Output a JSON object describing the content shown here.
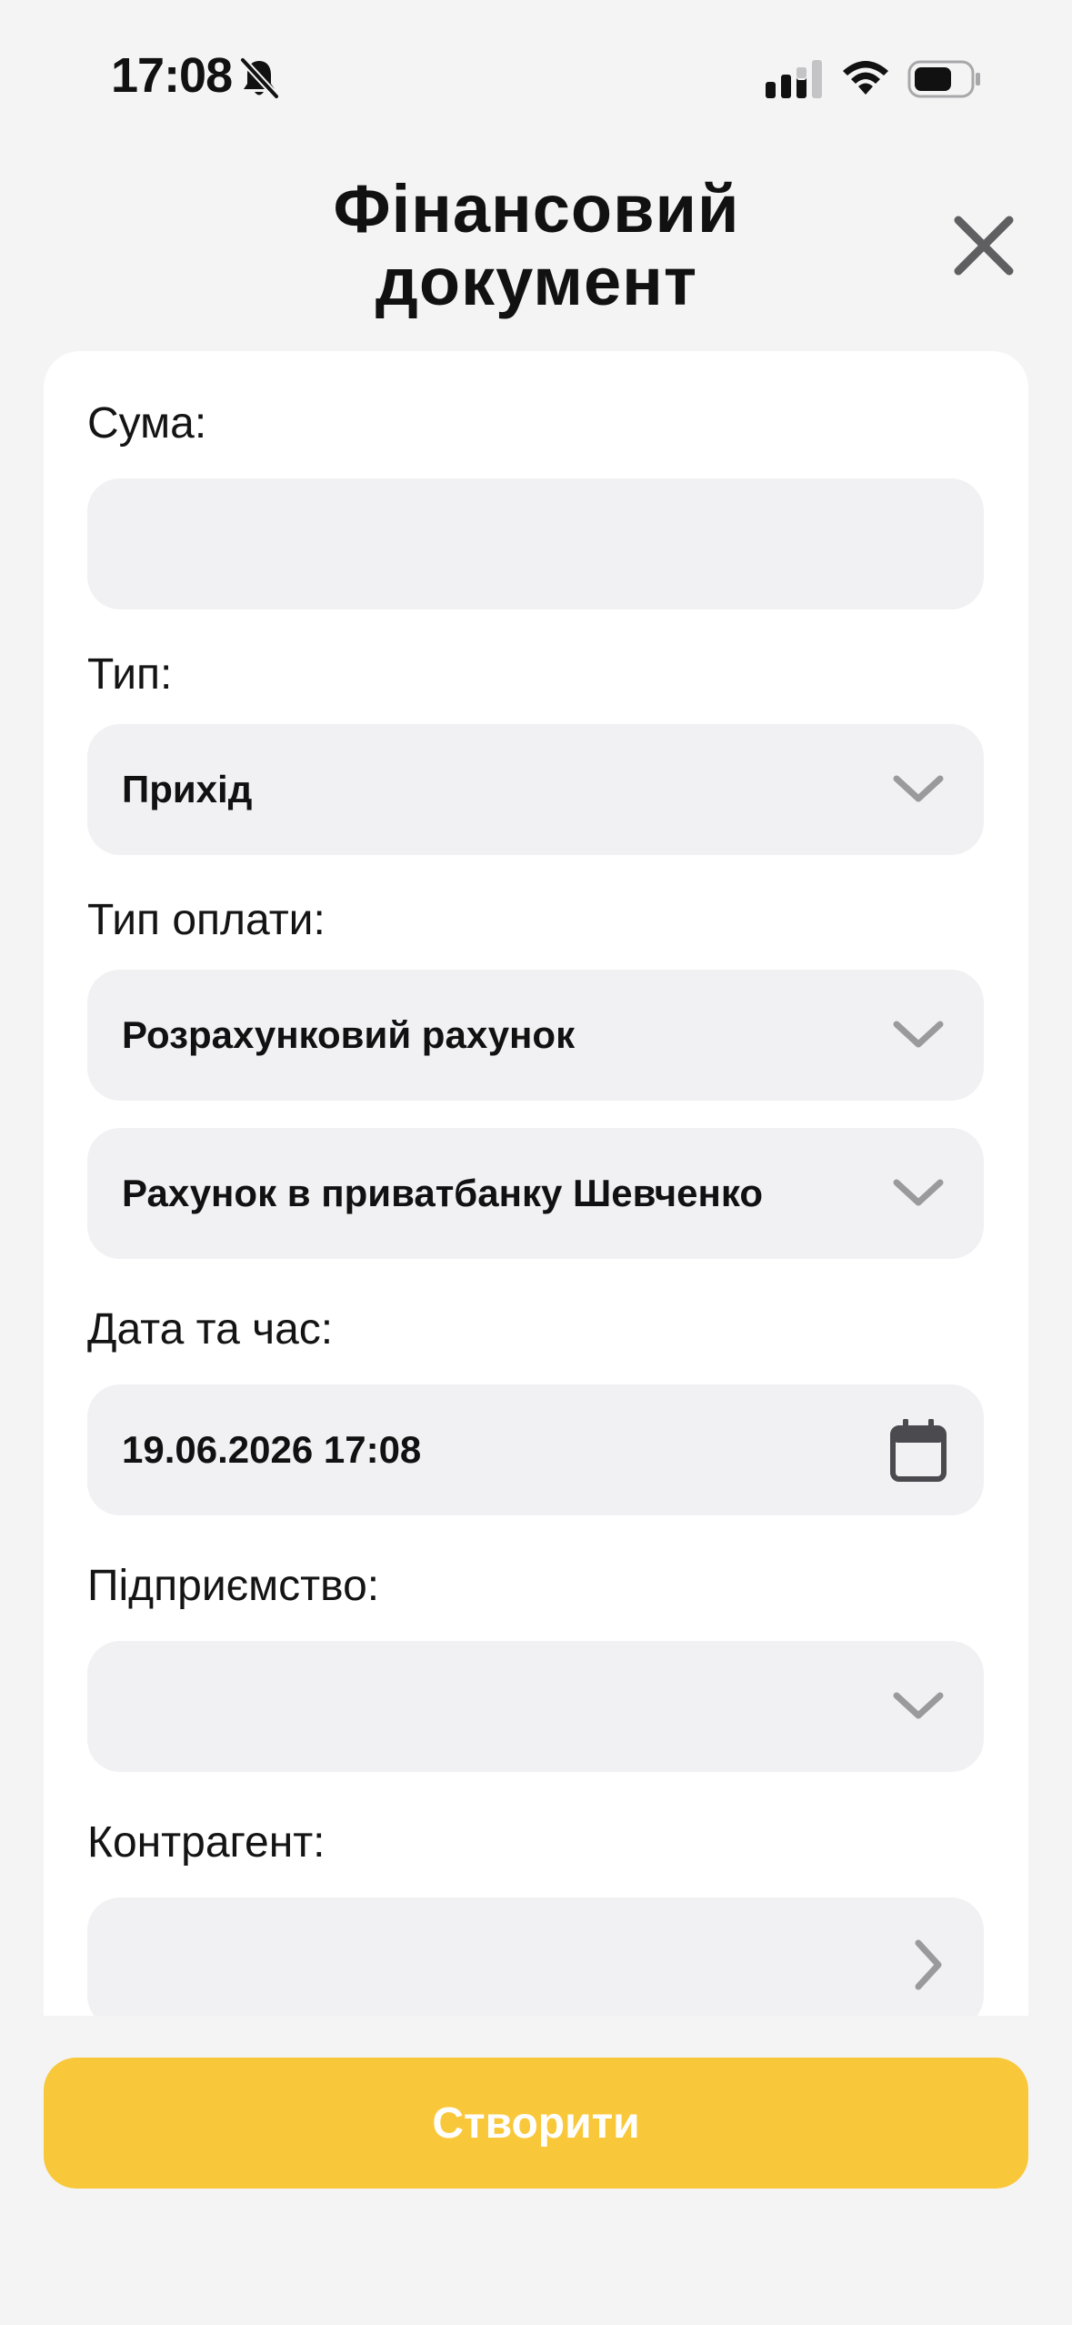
{
  "status_bar": {
    "time": "17:08",
    "icons": [
      "bell-slash-icon",
      "signal-icon",
      "wifi-icon",
      "battery-icon"
    ]
  },
  "header": {
    "title": "Фінансовий документ",
    "close_icon": "close-icon"
  },
  "form": {
    "amount": {
      "label": "Сума:",
      "value": ""
    },
    "type": {
      "label": "Тип:",
      "value": "Прихід"
    },
    "payment_type": {
      "label": "Тип оплати:",
      "value": "Розрахунковий рахунок"
    },
    "account": {
      "value": "Рахунок в приватбанку Шевченко"
    },
    "datetime": {
      "label": "Дата та час:",
      "value": "19.06.2026 17:08"
    },
    "enterprise": {
      "label": "Підприємство:",
      "value": ""
    },
    "counterparty": {
      "label": "Контрагент:",
      "value": ""
    }
  },
  "actions": {
    "create_label": "Створити"
  },
  "colors": {
    "background": "#f4f4f5",
    "field_background": "#f1f1f3",
    "accent": "#f9c83a",
    "chevron": "#9a9a9c"
  }
}
